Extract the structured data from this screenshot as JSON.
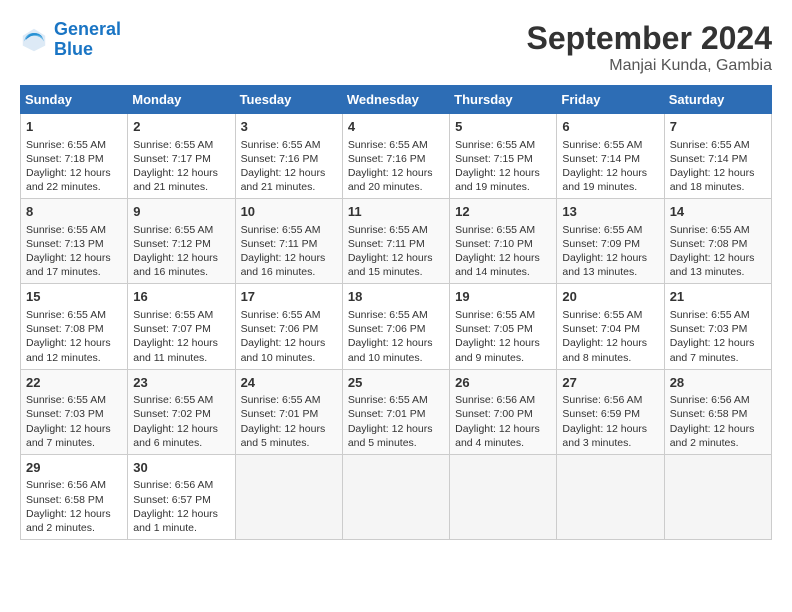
{
  "header": {
    "logo_line1": "General",
    "logo_line2": "Blue",
    "month": "September 2024",
    "location": "Manjai Kunda, Gambia"
  },
  "calendar": {
    "days_of_week": [
      "Sunday",
      "Monday",
      "Tuesday",
      "Wednesday",
      "Thursday",
      "Friday",
      "Saturday"
    ],
    "weeks": [
      [
        {
          "day": "",
          "empty": true
        },
        {
          "day": "",
          "empty": true
        },
        {
          "day": "",
          "empty": true
        },
        {
          "day": "",
          "empty": true
        },
        {
          "day": "",
          "empty": true
        },
        {
          "day": "",
          "empty": true
        },
        {
          "day": "",
          "empty": true
        }
      ]
    ],
    "cells": [
      {
        "date": "1",
        "sunrise": "6:55 AM",
        "sunset": "7:18 PM",
        "daylight": "12 hours and 22 minutes."
      },
      {
        "date": "2",
        "sunrise": "6:55 AM",
        "sunset": "7:17 PM",
        "daylight": "12 hours and 21 minutes."
      },
      {
        "date": "3",
        "sunrise": "6:55 AM",
        "sunset": "7:16 PM",
        "daylight": "12 hours and 21 minutes."
      },
      {
        "date": "4",
        "sunrise": "6:55 AM",
        "sunset": "7:16 PM",
        "daylight": "12 hours and 20 minutes."
      },
      {
        "date": "5",
        "sunrise": "6:55 AM",
        "sunset": "7:15 PM",
        "daylight": "12 hours and 19 minutes."
      },
      {
        "date": "6",
        "sunrise": "6:55 AM",
        "sunset": "7:14 PM",
        "daylight": "12 hours and 19 minutes."
      },
      {
        "date": "7",
        "sunrise": "6:55 AM",
        "sunset": "7:14 PM",
        "daylight": "12 hours and 18 minutes."
      },
      {
        "date": "8",
        "sunrise": "6:55 AM",
        "sunset": "7:13 PM",
        "daylight": "12 hours and 17 minutes."
      },
      {
        "date": "9",
        "sunrise": "6:55 AM",
        "sunset": "7:12 PM",
        "daylight": "12 hours and 16 minutes."
      },
      {
        "date": "10",
        "sunrise": "6:55 AM",
        "sunset": "7:11 PM",
        "daylight": "12 hours and 16 minutes."
      },
      {
        "date": "11",
        "sunrise": "6:55 AM",
        "sunset": "7:11 PM",
        "daylight": "12 hours and 15 minutes."
      },
      {
        "date": "12",
        "sunrise": "6:55 AM",
        "sunset": "7:10 PM",
        "daylight": "12 hours and 14 minutes."
      },
      {
        "date": "13",
        "sunrise": "6:55 AM",
        "sunset": "7:09 PM",
        "daylight": "12 hours and 13 minutes."
      },
      {
        "date": "14",
        "sunrise": "6:55 AM",
        "sunset": "7:08 PM",
        "daylight": "12 hours and 13 minutes."
      },
      {
        "date": "15",
        "sunrise": "6:55 AM",
        "sunset": "7:08 PM",
        "daylight": "12 hours and 12 minutes."
      },
      {
        "date": "16",
        "sunrise": "6:55 AM",
        "sunset": "7:07 PM",
        "daylight": "12 hours and 11 minutes."
      },
      {
        "date": "17",
        "sunrise": "6:55 AM",
        "sunset": "7:06 PM",
        "daylight": "12 hours and 10 minutes."
      },
      {
        "date": "18",
        "sunrise": "6:55 AM",
        "sunset": "7:06 PM",
        "daylight": "12 hours and 10 minutes."
      },
      {
        "date": "19",
        "sunrise": "6:55 AM",
        "sunset": "7:05 PM",
        "daylight": "12 hours and 9 minutes."
      },
      {
        "date": "20",
        "sunrise": "6:55 AM",
        "sunset": "7:04 PM",
        "daylight": "12 hours and 8 minutes."
      },
      {
        "date": "21",
        "sunrise": "6:55 AM",
        "sunset": "7:03 PM",
        "daylight": "12 hours and 7 minutes."
      },
      {
        "date": "22",
        "sunrise": "6:55 AM",
        "sunset": "7:03 PM",
        "daylight": "12 hours and 7 minutes."
      },
      {
        "date": "23",
        "sunrise": "6:55 AM",
        "sunset": "7:02 PM",
        "daylight": "12 hours and 6 minutes."
      },
      {
        "date": "24",
        "sunrise": "6:55 AM",
        "sunset": "7:01 PM",
        "daylight": "12 hours and 5 minutes."
      },
      {
        "date": "25",
        "sunrise": "6:55 AM",
        "sunset": "7:01 PM",
        "daylight": "12 hours and 5 minutes."
      },
      {
        "date": "26",
        "sunrise": "6:56 AM",
        "sunset": "7:00 PM",
        "daylight": "12 hours and 4 minutes."
      },
      {
        "date": "27",
        "sunrise": "6:56 AM",
        "sunset": "6:59 PM",
        "daylight": "12 hours and 3 minutes."
      },
      {
        "date": "28",
        "sunrise": "6:56 AM",
        "sunset": "6:58 PM",
        "daylight": "12 hours and 2 minutes."
      },
      {
        "date": "29",
        "sunrise": "6:56 AM",
        "sunset": "6:58 PM",
        "daylight": "12 hours and 2 minutes."
      },
      {
        "date": "30",
        "sunrise": "6:56 AM",
        "sunset": "6:57 PM",
        "daylight": "12 hours and 1 minute."
      }
    ]
  }
}
